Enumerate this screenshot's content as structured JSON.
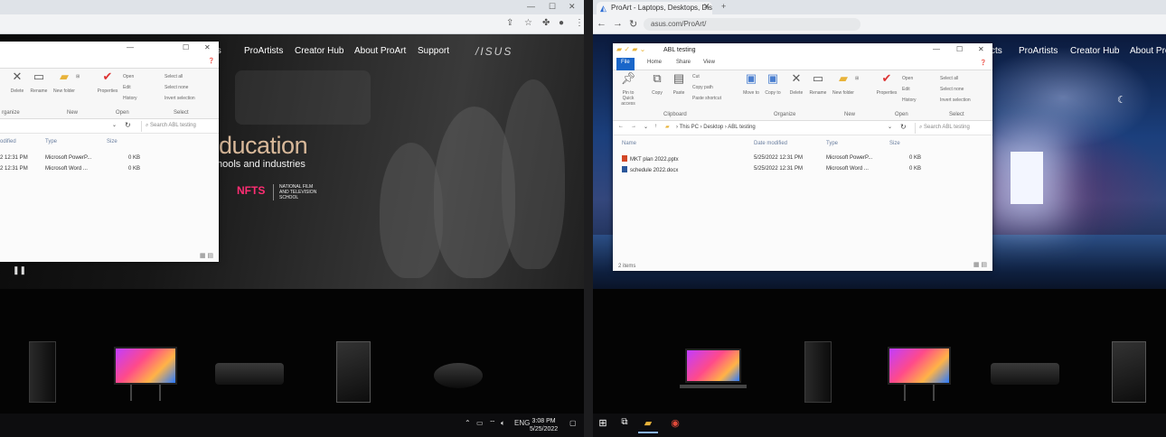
{
  "right_browser": {
    "tab_title": "ProArt - Laptops, Desktops, Disp...",
    "url": "asus.com/ProArt/",
    "nav_links": [
      "ProArtists",
      "Creator Hub",
      "About ProArt"
    ],
    "nav_partial": "cts"
  },
  "left_browser": {
    "nav_links": [
      "ProArtists",
      "Creator Hub",
      "About ProArt",
      "Support"
    ],
    "nav_partial": "cts",
    "logo": "/ISUS",
    "headline": "ducation",
    "subline": "hools and industries",
    "partner_logo": "NFTS",
    "partner_text": "NATIONAL FILM AND TELEVISION SCHOOL"
  },
  "left_explorer": {
    "ribbon": {
      "delete": "Delete",
      "rename": "Rename",
      "new_folder": "New folder",
      "properties": "Properties",
      "open": "Open",
      "edit": "Edit",
      "history": "History",
      "select_all": "Select all",
      "select_none": "Select none",
      "invert_selection": "Invert selection",
      "groups": [
        "rganize",
        "New",
        "Open",
        "Select"
      ]
    },
    "search_placeholder": "Search ABL testing",
    "columns": [
      "odified",
      "Type",
      "Size"
    ],
    "rows": [
      {
        "modified": "2 12:31 PM",
        "type": "Microsoft PowerP...",
        "size": "0 KB"
      },
      {
        "modified": "2 12:31 PM",
        "type": "Microsoft Word ...",
        "size": "0 KB"
      }
    ]
  },
  "right_explorer": {
    "title": "ABL testing",
    "tabs": [
      "File",
      "Home",
      "Share",
      "View"
    ],
    "ribbon": {
      "pin": "Pin to Quick access",
      "copy": "Copy",
      "paste": "Paste",
      "cut": "Cut",
      "copy_path": "Copy path",
      "paste_shortcut": "Paste shortcut",
      "move_to": "Move to",
      "copy_to": "Copy to",
      "delete": "Delete",
      "rename": "Rename",
      "new_folder": "New folder",
      "properties": "Properties",
      "open": "Open",
      "edit": "Edit",
      "history": "History",
      "select_all": "Select all",
      "select_none": "Select none",
      "invert_selection": "Invert selection",
      "groups": [
        "Clipboard",
        "Organize",
        "New",
        "Open",
        "Select"
      ]
    },
    "breadcrumb": [
      "This PC",
      "Desktop",
      "ABL testing"
    ],
    "search_placeholder": "Search ABL testing",
    "columns": [
      "Name",
      "Date modified",
      "Type",
      "Size"
    ],
    "rows": [
      {
        "name": "MKT plan 2022.pptx",
        "modified": "5/25/2022 12:31 PM",
        "type": "Microsoft PowerP...",
        "size": "0 KB"
      },
      {
        "name": "schedule 2022.docx",
        "modified": "5/25/2022 12:31 PM",
        "type": "Microsoft Word ...",
        "size": "0 KB"
      }
    ],
    "status": "2 items"
  },
  "left_taskbar": {
    "lang": "ENG",
    "time": "3:08 PM",
    "date": "5/25/2022"
  },
  "colors": {
    "accent_file_tab": "#1a66c9",
    "nfts_pink": "#ff2d73",
    "headline_gold": "#d9b99a"
  }
}
